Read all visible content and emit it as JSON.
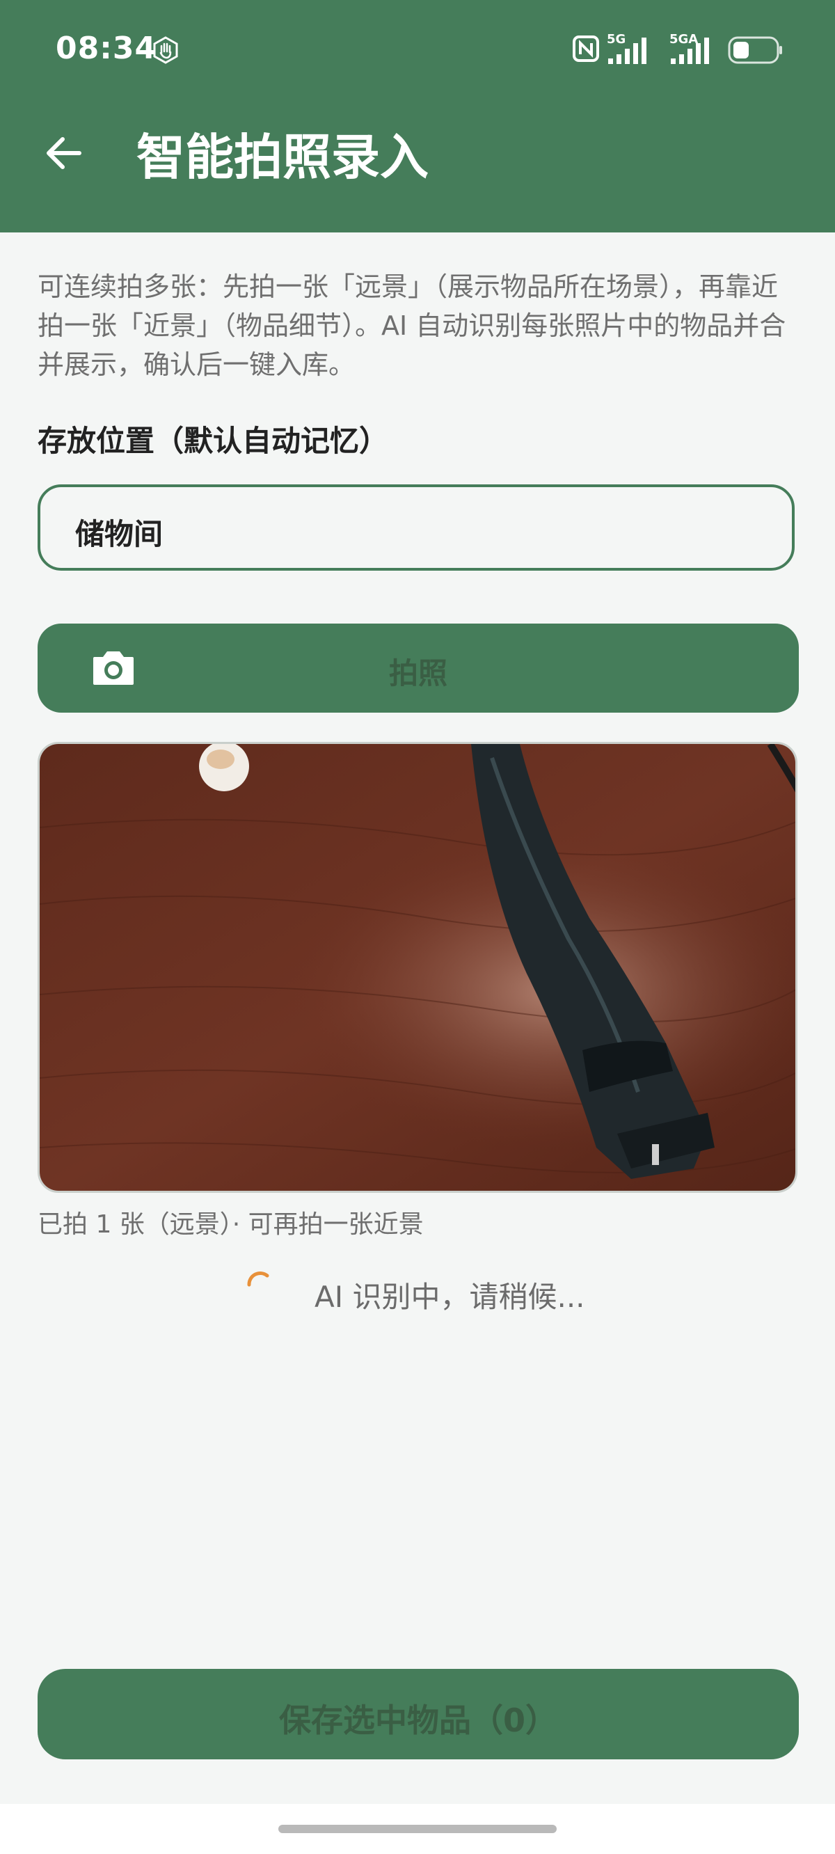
{
  "status_bar": {
    "time": "08:34",
    "network_1": "5G",
    "network_2": "5GA",
    "icons": [
      "hand-icon",
      "nfc-icon",
      "signal-icon",
      "signal-icon",
      "battery-icon"
    ]
  },
  "header": {
    "title": "智能拍照录入",
    "back_icon": "arrow-left-icon"
  },
  "intro_text": "可连续拍多张：先拍一张「远景」（展示物品所在场景），再靠近拍一张「近景」（物品细节）。AI 自动识别每张照片中的物品并合并展示，确认后一键入库。",
  "location": {
    "label": "存放位置（默认自动记忆）",
    "value": "储物间"
  },
  "photo_button": {
    "label": "拍照",
    "icon": "camera-icon"
  },
  "photo": {
    "caption": "已拍 1 张（远景）· 可再拍一张近景"
  },
  "loading": {
    "text": "AI 识别中，请稍候..."
  },
  "save_button": {
    "label": "保存选中物品（0）"
  },
  "colors": {
    "brand_green": "#457d5a",
    "background": "#f4f6f5",
    "spinner": "#e8913a"
  }
}
